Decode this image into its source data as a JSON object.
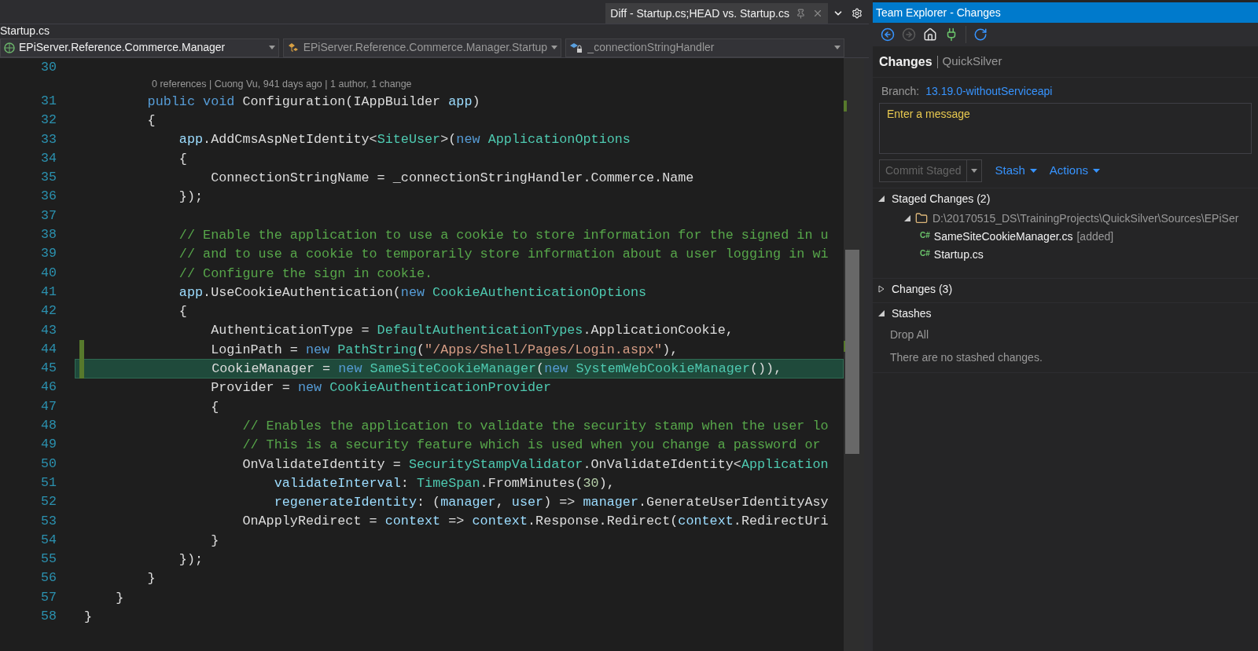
{
  "editor": {
    "tab": {
      "title": "Diff - Startup.cs;HEAD vs. Startup.cs"
    },
    "file_title": "Startup.cs",
    "nav_dropdowns": [
      {
        "label": "EPiServer.Reference.Commerce.Manager",
        "kind": "project",
        "dimmed": false
      },
      {
        "label": "EPiServer.Reference.Commerce.Manager.Startup",
        "kind": "class",
        "dimmed": true
      },
      {
        "label": "_connectionStringHandler",
        "kind": "field",
        "dimmed": true
      }
    ],
    "lines": [
      {
        "number": "30",
        "changed": false,
        "highlighted": false
      },
      {
        "number": "31",
        "changed": false,
        "highlighted": false,
        "codelens": "0 references | Cuong Vu, 941 days ago | 1 author, 1 change",
        "tokens": [
          {
            "kind": "keyword",
            "text": "        public"
          },
          {
            "kind": "keyword",
            "text": " void"
          },
          {
            "kind": "plain",
            "text": " Configuration(IAppBuilder "
          },
          {
            "kind": "variable",
            "text": "app"
          },
          {
            "kind": "plain",
            "text": ")"
          }
        ]
      },
      {
        "number": "32",
        "changed": false,
        "highlighted": false,
        "tokens": [
          {
            "kind": "plain",
            "text": "        {"
          }
        ]
      },
      {
        "number": "33",
        "changed": false,
        "highlighted": false,
        "tokens": [
          {
            "kind": "variable",
            "text": "            app"
          },
          {
            "kind": "plain",
            "text": ".AddCmsAspNetIdentity<"
          },
          {
            "kind": "type",
            "text": "SiteUser"
          },
          {
            "kind": "plain",
            "text": ">("
          },
          {
            "kind": "keyword",
            "text": "new"
          },
          {
            "kind": "type",
            "text": " ApplicationOptions"
          }
        ]
      },
      {
        "number": "34",
        "changed": false,
        "highlighted": false,
        "tokens": [
          {
            "kind": "plain",
            "text": "            {"
          }
        ]
      },
      {
        "number": "35",
        "changed": false,
        "highlighted": false,
        "tokens": [
          {
            "kind": "plain",
            "text": "                ConnectionStringName = _connectionStringHandler.Commerce.Name"
          }
        ]
      },
      {
        "number": "36",
        "changed": false,
        "highlighted": false,
        "tokens": [
          {
            "kind": "plain",
            "text": "            });"
          }
        ]
      },
      {
        "number": "37",
        "changed": false,
        "highlighted": false
      },
      {
        "number": "38",
        "changed": false,
        "highlighted": false,
        "tokens": [
          {
            "kind": "comment",
            "text": "            // Enable the application to use a cookie to store information for the signed in u"
          }
        ]
      },
      {
        "number": "39",
        "changed": false,
        "highlighted": false,
        "tokens": [
          {
            "kind": "comment",
            "text": "            // and to use a cookie to temporarily store information about a user logging in wi"
          }
        ]
      },
      {
        "number": "40",
        "changed": false,
        "highlighted": false,
        "tokens": [
          {
            "kind": "comment",
            "text": "            // Configure the sign in cookie."
          }
        ]
      },
      {
        "number": "41",
        "changed": false,
        "highlighted": false,
        "tokens": [
          {
            "kind": "variable",
            "text": "            app"
          },
          {
            "kind": "plain",
            "text": ".UseCookieAuthentication("
          },
          {
            "kind": "keyword",
            "text": "new"
          },
          {
            "kind": "type",
            "text": " CookieAuthenticationOptions"
          }
        ]
      },
      {
        "number": "42",
        "changed": false,
        "highlighted": false,
        "tokens": [
          {
            "kind": "plain",
            "text": "            {"
          }
        ]
      },
      {
        "number": "43",
        "changed": false,
        "highlighted": false,
        "tokens": [
          {
            "kind": "plain",
            "text": "                AuthenticationType = "
          },
          {
            "kind": "type",
            "text": "DefaultAuthenticationTypes"
          },
          {
            "kind": "plain",
            "text": ".ApplicationCookie,"
          }
        ]
      },
      {
        "number": "44",
        "changed": true,
        "highlighted": false,
        "tokens": [
          {
            "kind": "plain",
            "text": "                LoginPath = "
          },
          {
            "kind": "keyword",
            "text": "new"
          },
          {
            "kind": "type",
            "text": " PathString"
          },
          {
            "kind": "plain",
            "text": "("
          },
          {
            "kind": "string",
            "text": "\"/Apps/Shell/Pages/Login.aspx\""
          },
          {
            "kind": "plain",
            "text": "),"
          }
        ]
      },
      {
        "number": "45",
        "changed": true,
        "highlighted": true,
        "tokens": [
          {
            "kind": "plain",
            "text": "                CookieManager = "
          },
          {
            "kind": "keyword",
            "text": "new"
          },
          {
            "kind": "type",
            "text": " SameSiteCookieManager"
          },
          {
            "kind": "plain",
            "text": "("
          },
          {
            "kind": "keyword",
            "text": "new"
          },
          {
            "kind": "type",
            "text": " SystemWebCookieManager"
          },
          {
            "kind": "plain",
            "text": "()),"
          }
        ]
      },
      {
        "number": "46",
        "changed": false,
        "highlighted": false,
        "tokens": [
          {
            "kind": "plain",
            "text": "                Provider = "
          },
          {
            "kind": "keyword",
            "text": "new"
          },
          {
            "kind": "type",
            "text": " CookieAuthenticationProvider"
          }
        ]
      },
      {
        "number": "47",
        "changed": false,
        "highlighted": false,
        "tokens": [
          {
            "kind": "plain",
            "text": "                {"
          }
        ]
      },
      {
        "number": "48",
        "changed": false,
        "highlighted": false,
        "tokens": [
          {
            "kind": "comment",
            "text": "                    // Enables the application to validate the security stamp when the user lo"
          }
        ]
      },
      {
        "number": "49",
        "changed": false,
        "highlighted": false,
        "tokens": [
          {
            "kind": "comment",
            "text": "                    // This is a security feature which is used when you change a password or"
          }
        ]
      },
      {
        "number": "50",
        "changed": false,
        "highlighted": false,
        "tokens": [
          {
            "kind": "plain",
            "text": "                    OnValidateIdentity = "
          },
          {
            "kind": "type",
            "text": "SecurityStampValidator"
          },
          {
            "kind": "plain",
            "text": ".OnValidateIdentity<"
          },
          {
            "kind": "type",
            "text": "Application"
          }
        ]
      },
      {
        "number": "51",
        "changed": false,
        "highlighted": false,
        "tokens": [
          {
            "kind": "variable",
            "text": "                        validateInterval"
          },
          {
            "kind": "plain",
            "text": ": "
          },
          {
            "kind": "type",
            "text": "TimeSpan"
          },
          {
            "kind": "plain",
            "text": ".FromMinutes("
          },
          {
            "kind": "number",
            "text": "30"
          },
          {
            "kind": "plain",
            "text": "),"
          }
        ]
      },
      {
        "number": "52",
        "changed": false,
        "highlighted": false,
        "tokens": [
          {
            "kind": "variable",
            "text": "                        regenerateIdentity"
          },
          {
            "kind": "plain",
            "text": ": ("
          },
          {
            "kind": "variable",
            "text": "manager"
          },
          {
            "kind": "plain",
            "text": ", "
          },
          {
            "kind": "variable",
            "text": "user"
          },
          {
            "kind": "plain",
            "text": ") => "
          },
          {
            "kind": "variable",
            "text": "manager"
          },
          {
            "kind": "plain",
            "text": ".GenerateUserIdentityAsy"
          }
        ]
      },
      {
        "number": "53",
        "changed": false,
        "highlighted": false,
        "tokens": [
          {
            "kind": "plain",
            "text": "                    OnApplyRedirect = "
          },
          {
            "kind": "variable",
            "text": "context"
          },
          {
            "kind": "plain",
            "text": " => "
          },
          {
            "kind": "variable",
            "text": "context"
          },
          {
            "kind": "plain",
            "text": ".Response.Redirect("
          },
          {
            "kind": "variable",
            "text": "context"
          },
          {
            "kind": "plain",
            "text": ".RedirectUri"
          }
        ]
      },
      {
        "number": "54",
        "changed": false,
        "highlighted": false,
        "tokens": [
          {
            "kind": "plain",
            "text": "                }"
          }
        ]
      },
      {
        "number": "55",
        "changed": false,
        "highlighted": false,
        "tokens": [
          {
            "kind": "plain",
            "text": "            });"
          }
        ]
      },
      {
        "number": "56",
        "changed": false,
        "highlighted": false,
        "tokens": [
          {
            "kind": "plain",
            "text": "        }"
          }
        ]
      },
      {
        "number": "57",
        "changed": false,
        "highlighted": false,
        "tokens": [
          {
            "kind": "plain",
            "text": "    }"
          }
        ]
      },
      {
        "number": "58",
        "changed": false,
        "highlighted": false,
        "tokens": [
          {
            "kind": "plain",
            "text": "}"
          }
        ]
      }
    ]
  },
  "team_explorer": {
    "title": "Team Explorer - Changes",
    "toolbar": [
      {
        "kind": "back",
        "disabled": false
      },
      {
        "kind": "forward",
        "disabled": true
      },
      {
        "kind": "home",
        "disabled": false
      },
      {
        "kind": "connect",
        "disabled": false
      },
      {
        "kind": "refresh",
        "disabled": false
      }
    ],
    "page_title": "Changes",
    "repository": "QuickSilver",
    "branch": {
      "label": "Branch:",
      "name": "13.19.0-withoutServiceapi"
    },
    "message": {
      "placeholder": "Enter a message"
    },
    "commit_button": {
      "label": "Commit Staged",
      "disabled": true
    },
    "links": [
      "Stash",
      "Actions"
    ],
    "sections": [
      {
        "title": "Staged Changes (2)",
        "expanded": true,
        "children": [
          {
            "kind": "folder",
            "label": "D:\\20170515_DS\\TrainingProjects\\QuickSilver\\Sources\\EPiSer",
            "expanded": true,
            "children": [
              {
                "kind": "file",
                "icon": "C#",
                "label": "SameSiteCookieManager.cs",
                "tag": "[added]"
              },
              {
                "kind": "file",
                "icon": "C#",
                "label": "Startup.cs"
              }
            ]
          }
        ]
      },
      {
        "title": "Changes (3)",
        "expanded": false
      },
      {
        "title": "Stashes",
        "expanded": true,
        "action": "Drop All",
        "note": "There are no stashed changes."
      }
    ]
  }
}
